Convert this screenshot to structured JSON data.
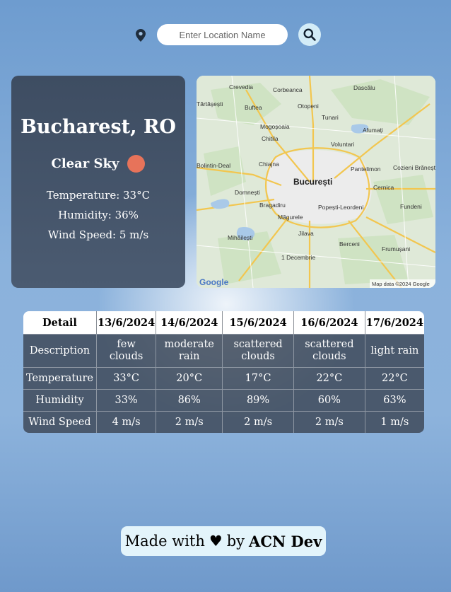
{
  "search": {
    "placeholder": "Enter Location Name"
  },
  "current": {
    "city": "Bucharest, RO",
    "condition": "Clear Sky",
    "temperature": "Temperature: 33°C",
    "humidity": "Humidity: 36%",
    "wind": "Wind Speed: 5 m/s"
  },
  "map": {
    "labels": [
      "Crevedia",
      "Corbeanca",
      "Dascălu",
      "Tărtășești",
      "Buftea",
      "Otopeni",
      "Tunari",
      "Mogoșoaia",
      "Chitila",
      "Afumați",
      "Voluntari",
      "Pantelimon",
      "Cernica",
      "Fundeni",
      "Chiajna",
      "Domnești",
      "Bragadiru",
      "Popești-Leordeni",
      "Măgurele",
      "Jilava",
      "Berceni",
      "Mihăilești",
      "Frumușani",
      "1 Decembrie",
      "Bolintin-Deal",
      "Cozieni Brănești",
      "București"
    ],
    "attribution": "Map data ©2024 Google",
    "logo": "Google"
  },
  "forecast": {
    "header": [
      "Detail",
      "13/6/2024",
      "14/6/2024",
      "15/6/2024",
      "16/6/2024",
      "17/6/2024"
    ],
    "rows": [
      [
        "Description",
        "few clouds",
        "moderate rain",
        "scattered clouds",
        "scattered clouds",
        "light rain"
      ],
      [
        "Temperature",
        "33°C",
        "20°C",
        "17°C",
        "22°C",
        "22°C"
      ],
      [
        "Humidity",
        "33%",
        "86%",
        "89%",
        "60%",
        "63%"
      ],
      [
        "Wind Speed",
        "4 m/s",
        "2 m/s",
        "2 m/s",
        "2 m/s",
        "1 m/s"
      ]
    ]
  },
  "footer": {
    "prefix": "Made with",
    "heart": "♥",
    "by": "by",
    "author": "ACN Dev"
  },
  "colors": {
    "accent_sun": "#e7735a",
    "card": "#445367",
    "search_btn": "#d3ecf7"
  }
}
